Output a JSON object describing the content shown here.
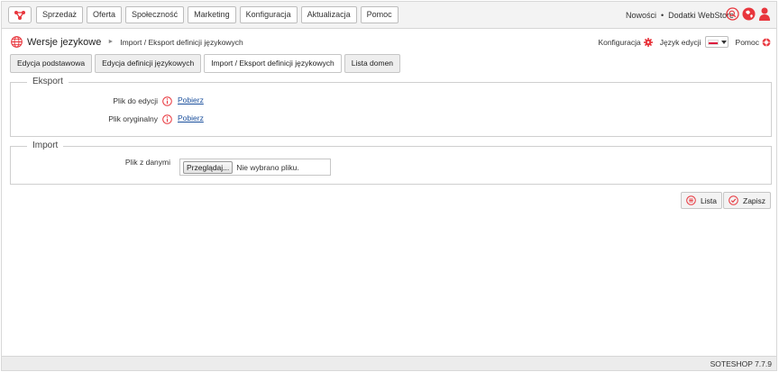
{
  "topnav": {
    "items": [
      "Sprzedaż",
      "Oferta",
      "Społeczność",
      "Marketing",
      "Konfiguracja",
      "Aktualizacja",
      "Pomoc"
    ],
    "news_label": "Nowości",
    "separator": "•",
    "addons_label": "Dodatki WebStore"
  },
  "breadcrumb": {
    "title": "Wersje jezykowe",
    "separator": "►",
    "current": "Import / Eksport definicji językowych"
  },
  "tools": {
    "config_label": "Konfiguracja",
    "language_label": "Język edycji",
    "help_label": "Pomoc"
  },
  "tabs": [
    {
      "label": "Edycja podstawowa",
      "active": false
    },
    {
      "label": "Edycja definicji językowych",
      "active": false
    },
    {
      "label": "Import / Eksport definicji językowych",
      "active": true
    },
    {
      "label": "Lista domen",
      "active": false
    }
  ],
  "export": {
    "legend": "Eksport",
    "rows": [
      {
        "label": "Plik do edycji",
        "link": "Pobierz"
      },
      {
        "label": "Plik oryginalny",
        "link": "Pobierz"
      }
    ]
  },
  "import": {
    "legend": "Import",
    "file_label": "Plik z danymi",
    "browse_label": "Przeglądaj...",
    "file_status": "Nie wybrano pliku."
  },
  "actions": {
    "list_label": "Lista",
    "save_label": "Zapisz"
  },
  "footer": {
    "version": "SOTESHOP 7.7.9"
  },
  "colors": {
    "accent": "#e8363d",
    "link": "#1a4f9c",
    "flag_red": "#dc143c"
  }
}
